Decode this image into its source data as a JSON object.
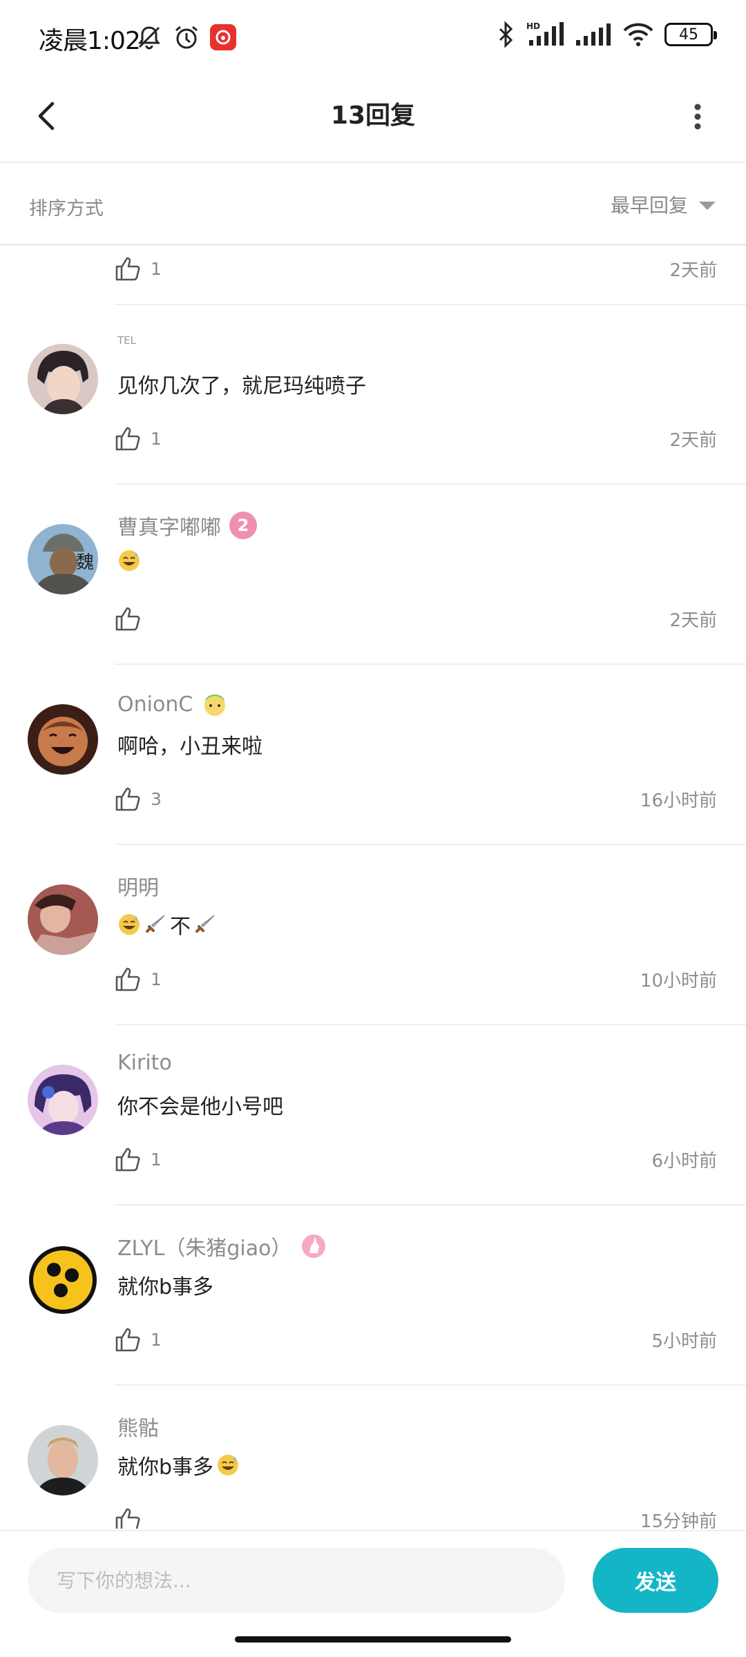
{
  "status_bar": {
    "time": "凌晨1:02",
    "battery": "45",
    "hd_label": "HD"
  },
  "header": {
    "title": "13回复"
  },
  "sort": {
    "label": "排序方式",
    "selected": "最早回复"
  },
  "first_partial": {
    "likes": "1",
    "time": "2天前"
  },
  "comments": [
    {
      "user": "TEL",
      "content": "见你几次了，就尼玛纯喷子",
      "likes": "1",
      "time": "2天前"
    },
    {
      "user": "曹真字嘟嘟",
      "badge": "2",
      "content": "",
      "likes": "",
      "time": "2天前"
    },
    {
      "user": "OnionC",
      "content": "啊哈，小丑来啦",
      "likes": "3",
      "time": "16小时前"
    },
    {
      "user": "明明",
      "content": "不",
      "likes": "1",
      "time": "10小时前"
    },
    {
      "user": "Kirito",
      "content": "你不会是他小号吧",
      "likes": "1",
      "time": "6小时前"
    },
    {
      "user": "ZLYL（朱猪giao）",
      "content": "就你b事多",
      "likes": "1",
      "time": "5小时前"
    },
    {
      "user": "熊骷",
      "content": "就你b事多",
      "likes": "",
      "time": "15分钟前"
    }
  ],
  "input": {
    "placeholder": "写下你的想法...",
    "send_label": "发送"
  },
  "colors": {
    "accent": "#14b6c6",
    "badge_pink": "#f08fb0"
  }
}
